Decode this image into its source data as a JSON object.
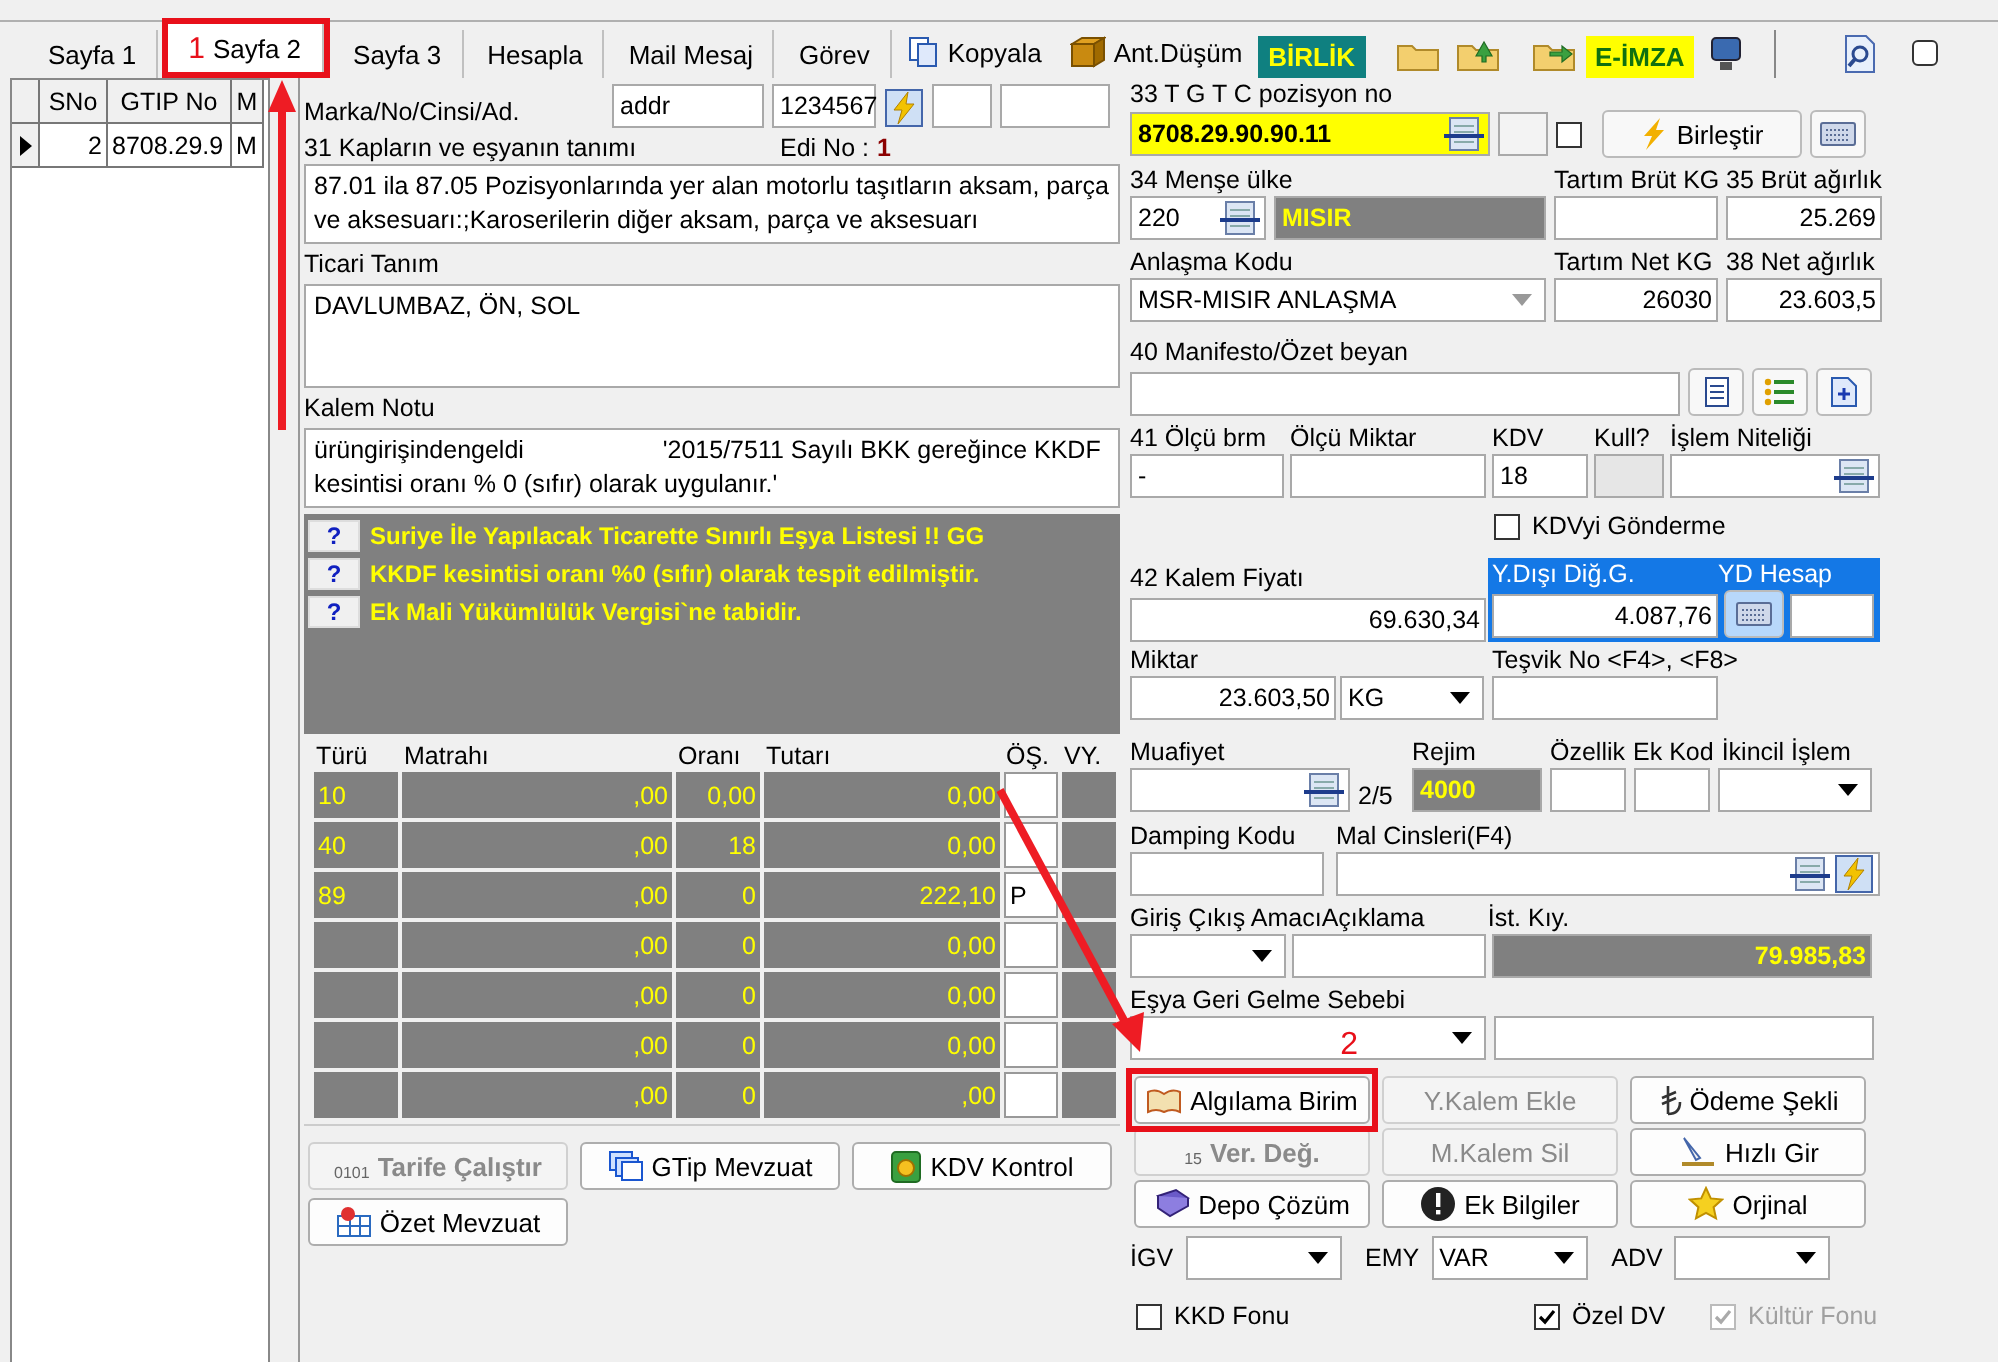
{
  "tabs": [
    {
      "label": "Sayfa 1",
      "selected": false
    },
    {
      "label": "Sayfa 2",
      "selected": true,
      "annotation": "1"
    },
    {
      "label": "Sayfa 3",
      "selected": false
    },
    {
      "label": "Hesapla",
      "selected": false
    },
    {
      "label": "Mail Mesaj",
      "selected": false
    },
    {
      "label": "Görev",
      "selected": false
    }
  ],
  "toolbar": {
    "copy": "Kopyala",
    "ant_dusum": "Ant.Düşüm",
    "birlik": "BİRLİK",
    "e_imza": "E-İMZA",
    "checked": false
  },
  "items_grid": {
    "columns": [
      "SNo",
      "GTIP No",
      "M"
    ],
    "rows": [
      {
        "selected": true,
        "cells": [
          "2",
          "8708.29.9",
          "M"
        ]
      }
    ]
  },
  "marka": {
    "label": "Marka/No/Cinsi/Ad.",
    "value_1": "addr",
    "value_2": "1234567"
  },
  "description": {
    "label": "31 Kapların ve eşyanın tanımı",
    "edi_label": "Edi No :",
    "edi_value": "1",
    "text": "87.01 ila 87.05 Pozisyonlarında yer alan motorlu taşıtların aksam, parça ve aksesuarı:;Karoserilerin diğer aksam, parça ve aksesuarı"
  },
  "ticari": {
    "label": "Ticari Tanım",
    "text": "DAVLUMBAZ, ÖN, SOL"
  },
  "kalem_notu": {
    "label": "Kalem Notu",
    "text": "ürüngirişindengeldi                    '2015/7511 Sayılı BKK gereğince KKDF kesintisi oranı % 0 (sıfır) olarak uygulanır.'"
  },
  "warnings": [
    {
      "button": "?",
      "text": "Suriye İle Yapılacak Ticarette Sınırlı Eşya Listesi !! GG"
    },
    {
      "button": "?",
      "text": "KKDF kesintisi oranı %0 (sıfır) olarak tespit edilmiştir."
    },
    {
      "button": "?",
      "text": "Ek Mali Yükümlülük Vergisi`ne tabidir."
    }
  ],
  "taxes": {
    "columns": [
      "Türü",
      "Matrahı",
      "Oranı",
      "Tutarı",
      "ÖŞ.",
      "VY."
    ],
    "rows": [
      {
        "turu": "10",
        "matrah": ",00",
        "oran": "0,00",
        "tutar": "0,00"
      },
      {
        "turu": "40",
        "matrah": ",00",
        "oran": "18",
        "tutar": "0,00"
      },
      {
        "turu": "89",
        "matrah": ",00",
        "oran": "0",
        "tutar": "222,10",
        "os": "P"
      },
      {
        "matrah": ",00",
        "oran": "0",
        "tutar": "0,00"
      },
      {
        "matrah": ",00",
        "oran": "0",
        "tutar": "0,00"
      },
      {
        "matrah": ",00",
        "oran": "0",
        "tutar": "0,00"
      },
      {
        "matrah": ",00",
        "oran": "0",
        "tutar": ",00"
      }
    ]
  },
  "left_buttons": [
    {
      "label": "Tarife Çalıştır",
      "disabled": true,
      "icon_text": "0101"
    },
    {
      "label": "GTip Mevzuat",
      "disabled": false
    },
    {
      "label": "KDV Kontrol",
      "disabled": false
    },
    {
      "label": "Özet Mevzuat",
      "disabled": false
    }
  ],
  "gtip": {
    "label": "33 T G T C pozisyon no",
    "value": "8708.29.90.90.11",
    "checked": false,
    "merge_button": "Birleştir"
  },
  "origin": {
    "label": "34 Menşe ülke",
    "code": "220",
    "name": "MISIR",
    "tartim_label": "Tartım Brüt KG",
    "gross_label": "35 Brüt ağırlık",
    "gross": "25.269"
  },
  "agreement": {
    "label": "Anlaşma Kodu",
    "value": "MSR-MISIR ANLAŞMA",
    "tartim_label": "Tartım Net KG",
    "tartim": "26030",
    "net_label": "38 Net ağırlık",
    "net": "23.603,5"
  },
  "manifest": {
    "label": "40 Manifesto/Özet beyan"
  },
  "measure": {
    "unit_label": "41 Ölçü brm",
    "unit": "-",
    "qty_label": "Ölçü Miktar",
    "kdv_label": "KDV",
    "kdv": "18",
    "kull_label": "Kull?",
    "islem_label": "İşlem Niteliği"
  },
  "kdv_send": {
    "label": "KDVyi Gönderme",
    "checked": false
  },
  "price": {
    "label": "42 Kalem Fiyatı",
    "value": "69.630,34",
    "ydisi_label": "Y.Dışı Diğ.G.",
    "ydisi": "4.087,76",
    "yd_label": "YD Hesap"
  },
  "quantity": {
    "label": "Miktar",
    "value": "23.603,50",
    "unit": "KG",
    "tesvik_label": "Teşvik No <F4>, <F8>"
  },
  "regime": {
    "muafiyet_label": "Muafiyet",
    "page": "2/5",
    "rejim_label": "Rejim",
    "rejim": "4000",
    "ozellik_label": "Özellik",
    "ek_kod_label": "Ek Kod",
    "ikincil_label": "İkincil İşlem"
  },
  "damping": {
    "label": "Damping Kodu",
    "mal_label": "Mal Cinsleri(F4)"
  },
  "purpose": {
    "label": "Giriş Çıkış Amacı",
    "aciklama_label": "Açıklama",
    "ist_label": "İst. Kıy.",
    "ist_value": "79.985,83"
  },
  "return_reason": {
    "label": "Eşya Geri Gelme Sebebi"
  },
  "actions": [
    {
      "label": "Algılama Birim",
      "disabled": false,
      "annotation": "2"
    },
    {
      "label": "Y.Kalem Ekle",
      "disabled": true
    },
    {
      "label": "Ödeme Şekli",
      "disabled": false
    },
    {
      "label": "Ver. Değ.",
      "disabled": true,
      "icon_text": "15"
    },
    {
      "label": "M.Kalem Sil",
      "disabled": true
    },
    {
      "label": "Hızlı Gir",
      "disabled": false
    },
    {
      "label": "Depo Çözüm",
      "disabled": false
    },
    {
      "label": "Ek Bilgiler",
      "disabled": false
    },
    {
      "label": "Orjinal",
      "disabled": false
    }
  ],
  "combos": [
    {
      "label": "İGV"
    },
    {
      "label": "EMY",
      "value": "VAR"
    },
    {
      "label": "ADV"
    }
  ],
  "checks": [
    {
      "label": "KKD Fonu",
      "checked": false,
      "disabled": false
    },
    {
      "label": "Özel DV",
      "checked": true,
      "disabled": false
    },
    {
      "label": "Kültür Fonu",
      "checked": true,
      "disabled": true
    }
  ]
}
